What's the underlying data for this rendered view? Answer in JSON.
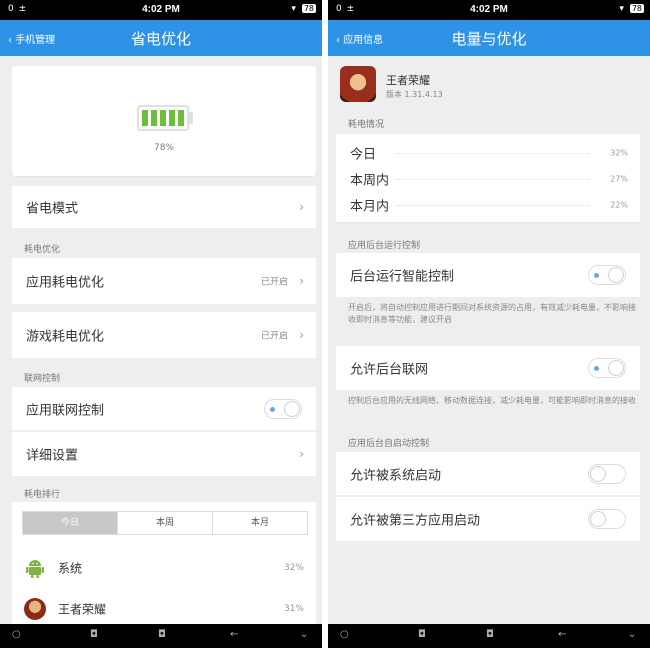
{
  "left": {
    "status": {
      "left": "0 ±",
      "time": "4:02 PM",
      "right": "▾",
      "battery": "78"
    },
    "header": {
      "back_label": "手机管理",
      "title": "省电优化"
    },
    "battery": {
      "percent": "78%",
      "level": 0.78
    },
    "power_mode": {
      "label": "省电模式"
    },
    "section_power_opt": "耗电优化",
    "app_power_opt": {
      "label": "应用耗电优化",
      "value": "已开启"
    },
    "game_power_opt": {
      "label": "游戏耗电优化",
      "value": "已开启"
    },
    "section_network": "联网控制",
    "app_network": {
      "label": "应用联网控制",
      "toggle": "on"
    },
    "detail_settings": {
      "label": "详细设置"
    },
    "section_ranking": "耗电排行",
    "tabs": [
      "今日",
      "本周",
      "本月"
    ],
    "active_tab": 0,
    "ranking": [
      {
        "name": "系统",
        "percent": "32%",
        "icon": "android-icon"
      },
      {
        "name": "王者荣耀",
        "percent": "31%",
        "icon": "game-app-icon"
      }
    ],
    "nav": {
      "menu": "≡",
      "home": "◘",
      "recent": "◘",
      "back": "←",
      "down": "⌄",
      "left_dot": "○"
    }
  },
  "right": {
    "status": {
      "left": "0 ±",
      "time": "4:02 PM",
      "right": "▾",
      "battery": "78"
    },
    "header": {
      "back_label": "应用信息",
      "title": "电量与优化"
    },
    "app": {
      "name": "王者荣耀",
      "version": "版本 1.31.4.13"
    },
    "section_usage": "耗电情况",
    "usage": [
      {
        "label": "今日",
        "percent": "32%"
      },
      {
        "label": "本周内",
        "percent": "27%"
      },
      {
        "label": "本月内",
        "percent": "22%"
      }
    ],
    "section_background": "应用后台运行控制",
    "smart_control": {
      "label": "后台运行智能控制",
      "toggle": "on"
    },
    "smart_control_desc": "开启后，将自动控制应用进行期间对系统资源的占用，有效减少耗电量，不影响接收即时消息等功能，建议开启",
    "background_network": {
      "label": "允许后台联网",
      "toggle": "on"
    },
    "background_network_desc": "控制后台应用的无线网络、移动数据连接，减少耗电量，可能影响即时消息的接收",
    "section_autostart": "应用后台自启动控制",
    "allow_system_start": {
      "label": "允许被系统启动",
      "toggle": "off"
    },
    "allow_third_party_start": {
      "label": "允许被第三方应用启动",
      "toggle": "off"
    },
    "nav": {
      "menu": "≡",
      "home": "◘",
      "recent": "◘",
      "back": "←",
      "down": "⌄",
      "left_dot": "○"
    }
  },
  "colors": {
    "accent": "#2e93e7",
    "battery_green": "#6cbf3a",
    "background": "#eeeeee"
  }
}
